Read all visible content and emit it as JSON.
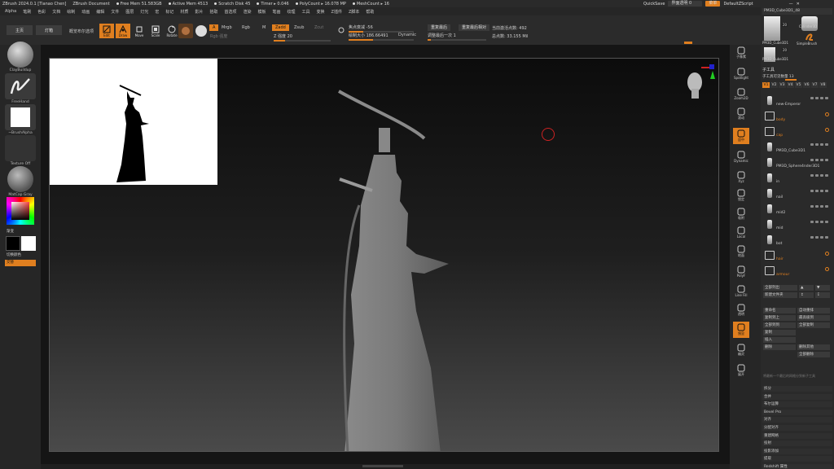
{
  "titlebar": {
    "app": "ZBrush 2024.0.1 [Tianao Chen]",
    "doc": "ZBrush Document",
    "free_mem": "Free Mem 51.583GB",
    "active_mem": "Active Mem 4513",
    "scratch": "Scratch Disk 45",
    "timer": "Timer ▸ 0.046",
    "polycount": "PolyCount ▸ 16.078 MP",
    "meshcount": "MeshCount ▸ 16",
    "quicksave": "QuickSave",
    "transparency": "界面透明 0",
    "menus_btn": "菜单",
    "script": "DefaultZScript",
    "win_min": "—",
    "win_close": "✕"
  },
  "menubar": [
    "Alpha",
    "笔刷",
    "色彩",
    "文档",
    "绘制",
    "动画",
    "编辑",
    "文件",
    "图层",
    "灯光",
    "宏",
    "标记",
    "材质",
    "影片",
    "拾取",
    "首选项",
    "渲染",
    "模板",
    "笔画",
    "纹理",
    "工具",
    "变换",
    "Z插件",
    "Z脚本",
    "帮助"
  ],
  "shelf": {
    "lightbox": "主页",
    "lightbox2": "灯箱",
    "quick_tools": "概览布尔选项",
    "icons": [
      {
        "name": "edit-icon",
        "label": "Edit",
        "active": true
      },
      {
        "name": "draw-icon",
        "label": "Draw",
        "active": true
      },
      {
        "name": "move-icon",
        "label": "Move",
        "active": false
      },
      {
        "name": "scale-icon",
        "label": "Scale",
        "active": false
      },
      {
        "name": "rotate-icon",
        "label": "Rotate",
        "active": false
      }
    ],
    "a_label": "A",
    "mrgb": "Mrgb",
    "rgb": "Rgb",
    "m": "M",
    "zadd": "Zadd",
    "zsub": "Zsub",
    "zcut": "Zcut",
    "rgb_intensity": "Rgb 强度",
    "z_intensity": "Z 强度 20",
    "focal_shift": "焦点衰减 -56",
    "draw_size": "绘制大小 186.66491",
    "dynamic": "Dynamic",
    "fill_last": "重复最后",
    "fill_last_rel": "重复最后相对",
    "active_points": "当前激活点数: 492",
    "total_points": "总点数: 33.155 Mil",
    "adjust_last": "调整最后一次 1"
  },
  "lefttray": {
    "brush": "ClayBuildup",
    "stroke": "FreeHand",
    "alpha": "~BrushAlpha",
    "texture": "Texture Off",
    "material": "MatCap Gray",
    "gradient": "渐变",
    "switch_color": "切换颜色",
    "alternate": "交替"
  },
  "rstrip": [
    {
      "name": "subtool-master-icon",
      "label": "子像素"
    },
    {
      "name": "spotlight-icon",
      "label": "Spotlight"
    },
    {
      "name": "zoom2d-icon",
      "label": "Zoom2D"
    },
    {
      "name": "scroll-icon",
      "label": "滚动"
    },
    {
      "name": "frame-icon",
      "label": "居中",
      "active": true
    },
    {
      "name": "dynamic-persp-icon",
      "label": "Dynamic"
    },
    {
      "name": "xyz-icon",
      "label": "Xyz"
    },
    {
      "name": "lock-icon",
      "label": "锁定"
    },
    {
      "name": "snap-icon",
      "label": "吸附"
    },
    {
      "name": "local-icon",
      "label": "Local"
    },
    {
      "name": "floor-icon",
      "label": "地面"
    },
    {
      "name": "poly-frame-icon",
      "label": "PolyF"
    },
    {
      "name": "line-fill-icon",
      "label": "Line Fill"
    },
    {
      "name": "transp-icon",
      "label": "透明"
    },
    {
      "name": "solo-icon",
      "label": "独显",
      "active": true
    },
    {
      "name": "ghost-icon",
      "label": "幽灵"
    },
    {
      "name": "xpose-icon",
      "label": "展开"
    }
  ],
  "rpanel": {
    "tool_name": "PM3D_Cube3D1_48",
    "thumb1": "PM3D_Cube3D1",
    "thumb2": "Cylinder3D",
    "thumb3": "SimpleBrush",
    "thumb4": "PM3D_Cube3D1",
    "count1": "20",
    "count2": "20",
    "subtool_title": "子工具",
    "subtool_count": "子工具可见数量 13",
    "tabs": [
      "V1",
      "V2",
      "V3",
      "V4",
      "V5",
      "V6",
      "V7",
      "V8"
    ],
    "subtools": [
      {
        "name": "new-Emperor",
        "type": "mesh",
        "color": "gray"
      },
      {
        "name": "body",
        "type": "folder",
        "color": "orange"
      },
      {
        "name": "cap",
        "type": "folder",
        "color": "orange"
      },
      {
        "name": "PM3D_Cube3D1",
        "type": "mesh",
        "color": "gray"
      },
      {
        "name": "PM3D_Sphere4nder3D1",
        "type": "mesh",
        "color": "gray"
      },
      {
        "name": "in",
        "type": "mesh",
        "color": "gray"
      },
      {
        "name": "nail",
        "type": "mesh",
        "color": "gray"
      },
      {
        "name": "mid2",
        "type": "mesh",
        "color": "gray"
      },
      {
        "name": "mid",
        "type": "mesh",
        "color": "gray"
      },
      {
        "name": "bot",
        "type": "mesh",
        "color": "gray"
      },
      {
        "name": "hair",
        "type": "folder",
        "color": "orange"
      },
      {
        "name": "armour",
        "type": "folder",
        "color": "orange"
      }
    ],
    "list_all": "全部列出",
    "new_folder": "新建文件夹",
    "actions": [
      [
        "重命名",
        "自动重排"
      ],
      [
        "复制到上",
        "最高级到"
      ],
      [
        "全部到到",
        "全部复制"
      ],
      [
        "复制",
        ""
      ],
      [
        "插入",
        ""
      ],
      [
        "删除",
        "删除其他"
      ],
      [
        "",
        "全部删除"
      ]
    ],
    "split_desc": "将最新一个最后的网格分到新子工具",
    "menu": [
      "拆分",
      "合并",
      "布尔运算",
      "Bevel Pro",
      "对齐",
      "分配对齐",
      "重建网格",
      "投射",
      "投影添加",
      "提取",
      "Redshift 属性"
    ]
  }
}
